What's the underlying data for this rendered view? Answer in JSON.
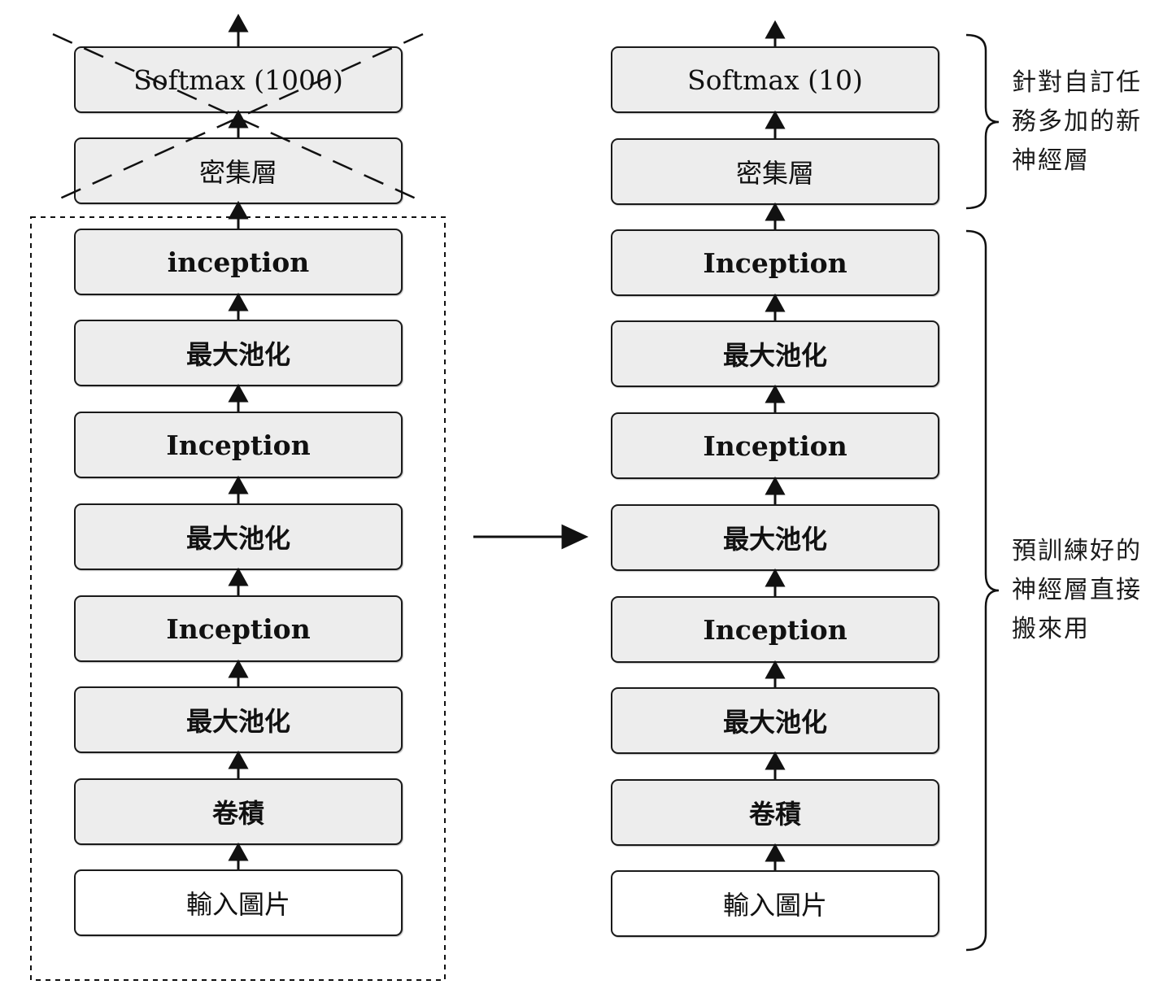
{
  "left_stack": {
    "layers": [
      "Softmax (1000)",
      "密集層",
      "inception",
      "最大池化",
      "Inception",
      "最大池化",
      "Inception",
      "最大池化",
      "卷積",
      "輸入圖片"
    ]
  },
  "right_stack": {
    "layers": [
      "Softmax (10)",
      "密集層",
      "Inception",
      "最大池化",
      "Inception",
      "最大池化",
      "Inception",
      "最大池化",
      "卷積",
      "輸入圖片"
    ]
  },
  "annotations": {
    "new_layers_line1": "針對自訂任",
    "new_layers_line2": "務多加的新",
    "new_layers_line3": "神經層",
    "pretrained_line1": "預訓練好的",
    "pretrained_line2": "神經層直接",
    "pretrained_line3": "搬來用"
  }
}
